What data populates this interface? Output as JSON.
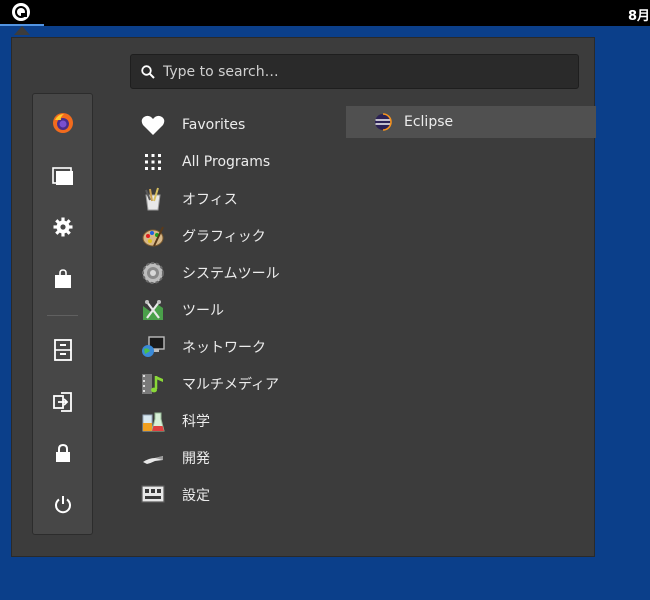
{
  "topbar": {
    "clock": "8月"
  },
  "search": {
    "placeholder": "Type to search…"
  },
  "sidebar": {
    "items": [
      {
        "name": "firefox-icon"
      },
      {
        "name": "folder-icon"
      },
      {
        "name": "gear-icon"
      },
      {
        "name": "shopping-bag-icon"
      },
      {
        "name": "cabinet-icon"
      },
      {
        "name": "logout-icon"
      },
      {
        "name": "lock-icon"
      },
      {
        "name": "power-icon"
      }
    ]
  },
  "categories": [
    {
      "label": "Favorites",
      "icon": "heart-icon"
    },
    {
      "label": "All Programs",
      "icon": "grid-icon"
    },
    {
      "label": "オフィス",
      "icon": "office-icon"
    },
    {
      "label": "グラフィック",
      "icon": "graphics-icon"
    },
    {
      "label": "システムツール",
      "icon": "system-tools-icon"
    },
    {
      "label": "ツール",
      "icon": "tools-icon"
    },
    {
      "label": "ネットワーク",
      "icon": "network-icon"
    },
    {
      "label": "マルチメディア",
      "icon": "multimedia-icon"
    },
    {
      "label": "科学",
      "icon": "science-icon"
    },
    {
      "label": "開発",
      "icon": "development-icon"
    },
    {
      "label": "設定",
      "icon": "settings-icon"
    }
  ],
  "apps": [
    {
      "label": "Eclipse",
      "icon": "eclipse-icon"
    }
  ],
  "colors": {
    "desktop": "#0b3f8a",
    "menu_bg": "#3c3c3c",
    "accent": "#5294e2"
  }
}
